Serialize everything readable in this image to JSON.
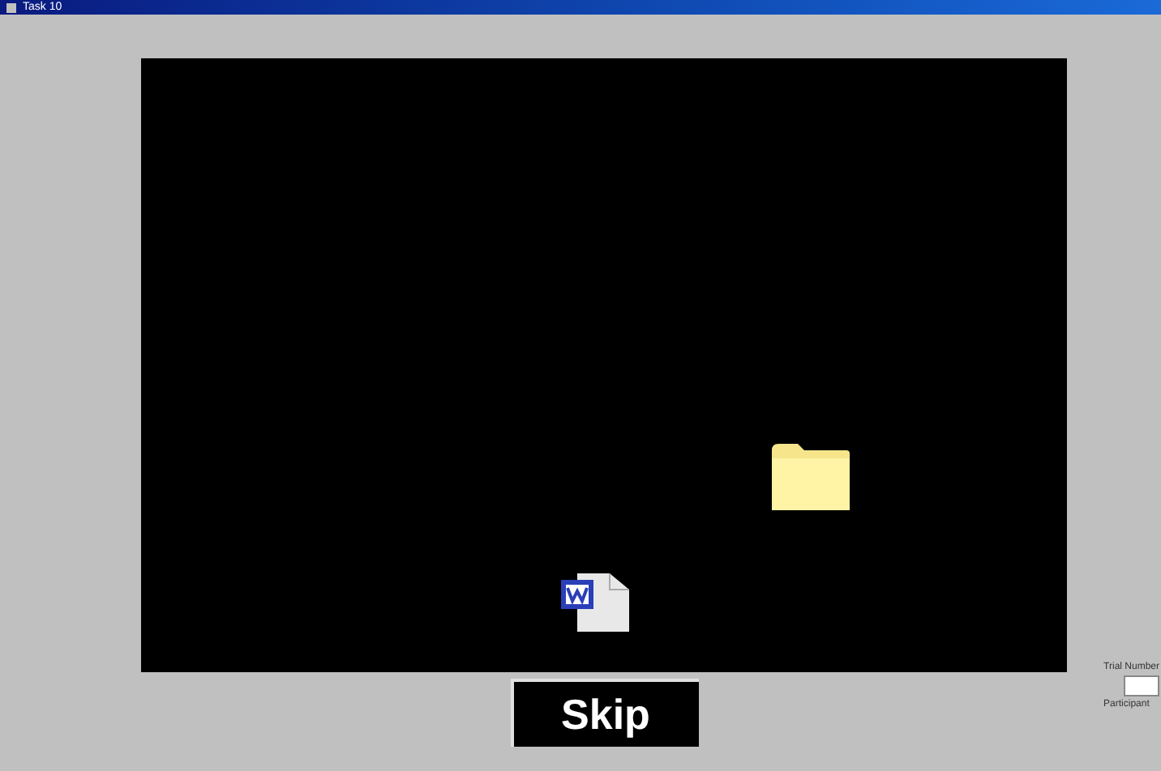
{
  "window": {
    "title": "Task 10"
  },
  "side_panel": {
    "trial_label": "Trial Number",
    "participant_label": "Participant"
  },
  "skip_button": {
    "label": "Skip"
  }
}
